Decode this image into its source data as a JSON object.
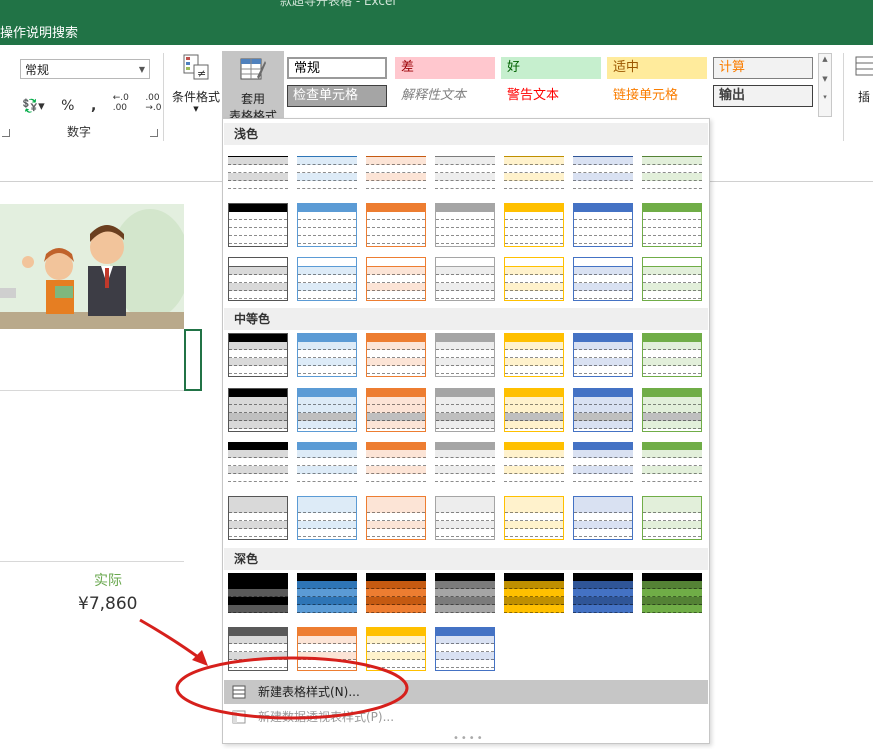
{
  "window": {
    "title": "款超导开表格 - Excel",
    "tell_me": "操作说明搜索"
  },
  "ribbon": {
    "number_format_value": "常规",
    "number_group_label": "数字",
    "number_buttons": [
      "%",
      ","
    ],
    "cond_format_label": "条件格式",
    "table_format_label_1": "套用",
    "table_format_label_2": "表格格式",
    "insert_label": "插",
    "cell_styles": [
      {
        "label": "常规",
        "bg": "#ffffff",
        "fg": "#000000",
        "border": "#9a9a9a"
      },
      {
        "label": "差",
        "bg": "#ffc7ce",
        "fg": "#9c0006",
        "border": "#ffc7ce"
      },
      {
        "label": "好",
        "bg": "#c6efce",
        "fg": "#006100",
        "border": "#c6efce"
      },
      {
        "label": "适中",
        "bg": "#ffeb9c",
        "fg": "#9c5700",
        "border": "#ffeb9c"
      },
      {
        "label": "计算",
        "bg": "#f2f2f2",
        "fg": "#fa7d00",
        "border": "#7f7f7f"
      },
      {
        "label": "检查单元格",
        "bg": "#a5a5a5",
        "fg": "#ffffff",
        "border": "#3f3f3f"
      },
      {
        "label": "解释性文本",
        "bg": "#ffffff",
        "fg": "#7f7f7f",
        "border": "#ffffff"
      },
      {
        "label": "警告文本",
        "bg": "#ffffff",
        "fg": "#ff0000",
        "border": "#ffffff"
      },
      {
        "label": "链接单元格",
        "bg": "#ffffff",
        "fg": "#fa7d00",
        "border": "#ffffff"
      },
      {
        "label": "输出",
        "bg": "#f2f2f2",
        "fg": "#3f3f3f",
        "border": "#3f3f3f"
      }
    ]
  },
  "sheet": {
    "actual_label": "实际",
    "actual_value": "¥7,860"
  },
  "gallery": {
    "sections": [
      "浅色",
      "中等色",
      "深色"
    ],
    "palette": [
      "#595959",
      "#5b9bd5",
      "#ed7d31",
      "#a5a5a5",
      "#ffc000",
      "#4472c4",
      "#70ad47"
    ],
    "palette_light": [
      "#d9d9d9",
      "#ddebf7",
      "#fce4d6",
      "#ededed",
      "#fff2cc",
      "#d9e1f2",
      "#e2efda"
    ],
    "palette_dark": [
      "#000000",
      "#2e75b6",
      "#c55a11",
      "#7b7b7b",
      "#bf8f00",
      "#2f5597",
      "#548235"
    ]
  },
  "menu": {
    "new_table_style": "新建表格样式(N)...",
    "new_pivot_style": "新建数据透视表样式(P)..."
  },
  "colors": {
    "excel_green": "#217346",
    "annotation_red": "#d6201c"
  }
}
